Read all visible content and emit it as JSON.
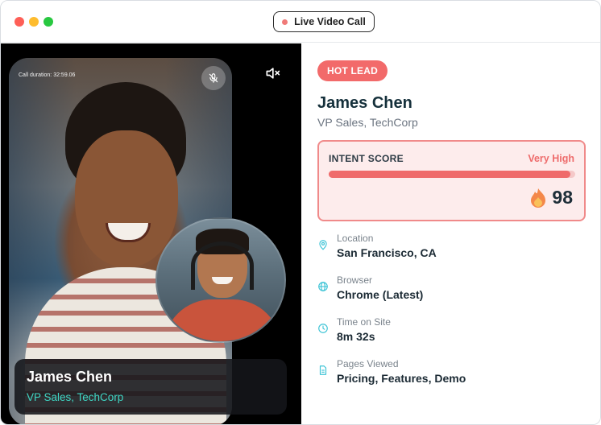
{
  "window": {
    "title": "Live Video Call"
  },
  "video": {
    "call_duration": "Call duration: 32:59.06",
    "caller": {
      "name": "James Chen",
      "role": "VP Sales, TechCorp"
    }
  },
  "lead": {
    "badge": "HOT LEAD",
    "name": "James Chen",
    "role": "VP Sales, TechCorp",
    "intent": {
      "label": "INTENT SCORE",
      "level": "Very High",
      "score": "98",
      "score_fraction": 0.98
    },
    "details": [
      {
        "icon": "location-pin-icon",
        "label": "Location",
        "value": "San Francisco, CA"
      },
      {
        "icon": "globe-icon",
        "label": "Browser",
        "value": "Chrome (Latest)"
      },
      {
        "icon": "clock-icon",
        "label": "Time on Site",
        "value": "8m 32s"
      },
      {
        "icon": "document-icon",
        "label": "Pages Viewed",
        "value": "Pricing, Features, Demo"
      }
    ]
  },
  "colors": {
    "accent_red": "#f26a6a",
    "accent_teal": "#3fd6c4",
    "dark_text": "#15303b"
  }
}
